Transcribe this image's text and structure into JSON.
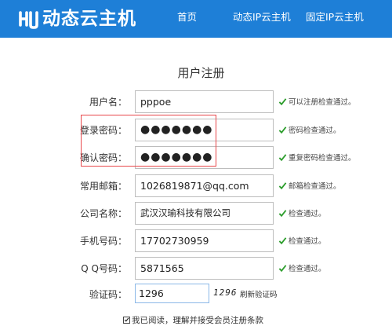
{
  "header": {
    "logo_text": "动态云主机",
    "nav": [
      "首页",
      "动态IP云主机",
      "固定IP云主机"
    ]
  },
  "form": {
    "title": "用户注册",
    "fields": [
      {
        "label": "用户名：",
        "value": "pppoe",
        "hint": "可以注册检查通过。"
      },
      {
        "label": "登录密码：",
        "value": "●●●●●●●",
        "hint": "密码检查通过。"
      },
      {
        "label": "确认密码：",
        "value": "●●●●●●●",
        "hint": "重复密码检查通过。"
      },
      {
        "label": "常用邮箱：",
        "value": "1026819871@qq.com",
        "hint": "邮箱检查通过。"
      },
      {
        "label": "公司名称：",
        "value": "武汉汉瑜科技有限公司",
        "hint": "检查通过。"
      },
      {
        "label": "手机号码：",
        "value": "17702730959",
        "hint": "检查通过。"
      },
      {
        "label": "Q Q号码：",
        "value": "5871565",
        "hint": "检查通过。"
      }
    ],
    "captcha": {
      "label": "验证码：",
      "value": "1296",
      "image_text": "1296",
      "refresh_label": "刷新验证码"
    },
    "agreement": {
      "checked": true,
      "text": "我已阅读，理解并接受会员注册条款"
    }
  },
  "colors": {
    "header_bg": "#1e7fd7",
    "check_green": "#2e9e2e",
    "highlight_red": "#e8484b"
  },
  "icons": {
    "logo": "cloud-logo-icon",
    "hint": "check-icon",
    "agreement": "checkbox-icon"
  }
}
